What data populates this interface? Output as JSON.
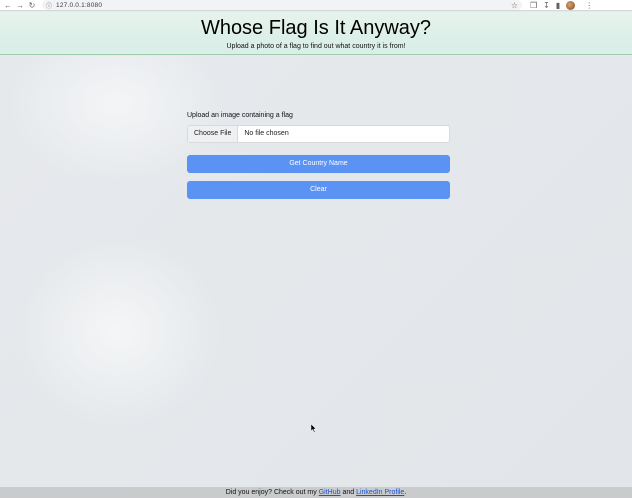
{
  "browser": {
    "url": "127.0.0.1:8080"
  },
  "header": {
    "title": "Whose Flag Is It Anyway?",
    "subtitle": "Upload a photo of a flag to find out what country it is from!"
  },
  "form": {
    "label": "Upload an image containing a flag",
    "choose_file_label": "Choose File",
    "file_status": "No file chosen",
    "get_country_label": "Get Country Name",
    "clear_label": "Clear"
  },
  "footer": {
    "prefix": "Did you enjoy? Check out my",
    "github_label": "GitHub",
    "and": "and",
    "linkedin_label": "LinkedIn Profile",
    "suffix": "."
  },
  "colors": {
    "button": "#5b93f5",
    "header_border": "#9fcfa9",
    "link": "#1a52d6"
  }
}
